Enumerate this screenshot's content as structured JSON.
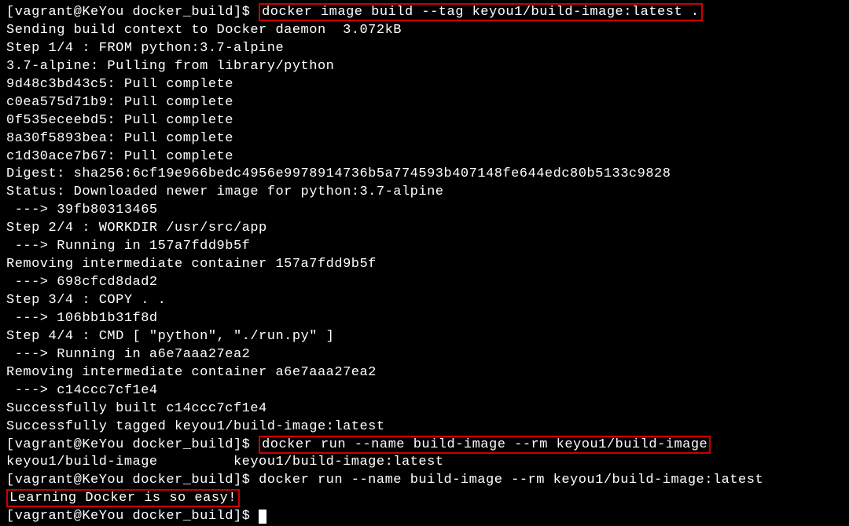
{
  "terminal": {
    "prompt1": "[vagrant@KeYou docker_build]$ ",
    "cmd1": "docker image build --tag keyou1/build-image:latest .",
    "line2": "Sending build context to Docker daemon  3.072kB",
    "line3": "Step 1/4 : FROM python:3.7-alpine",
    "line4": "3.7-alpine: Pulling from library/python",
    "line5": "9d48c3bd43c5: Pull complete",
    "line6": "c0ea575d71b9: Pull complete",
    "line7": "0f535eceebd5: Pull complete",
    "line8": "8a30f5893bea: Pull complete",
    "line9": "c1d30ace7b67: Pull complete",
    "line10": "Digest: sha256:6cf19e966bedc4956e9978914736b5a774593b407148fe644edc80b5133c9828",
    "line11": "Status: Downloaded newer image for python:3.7-alpine",
    "line12": " ---> 39fb80313465",
    "line13": "Step 2/4 : WORKDIR /usr/src/app",
    "line14": " ---> Running in 157a7fdd9b5f",
    "line15": "Removing intermediate container 157a7fdd9b5f",
    "line16": " ---> 698cfcd8dad2",
    "line17": "Step 3/4 : COPY . .",
    "line18": " ---> 106bb1b31f8d",
    "line19": "Step 4/4 : CMD [ \"python\", \"./run.py\" ]",
    "line20": " ---> Running in a6e7aaa27ea2",
    "line21": "Removing intermediate container a6e7aaa27ea2",
    "line22": " ---> c14ccc7cf1e4",
    "line23": "Successfully built c14ccc7cf1e4",
    "line24": "Successfully tagged keyou1/build-image:latest",
    "prompt2": "[vagrant@KeYou docker_build]$ ",
    "cmd2": "docker run --name build-image --rm keyou1/build-image",
    "line26": "keyou1/build-image         keyou1/build-image:latest",
    "prompt3": "[vagrant@KeYou docker_build]$ ",
    "cmd3": "docker run --name build-image --rm keyou1/build-image:latest",
    "line28": "Learning Docker is so easy!",
    "prompt4": "[vagrant@KeYou docker_build]$ "
  }
}
